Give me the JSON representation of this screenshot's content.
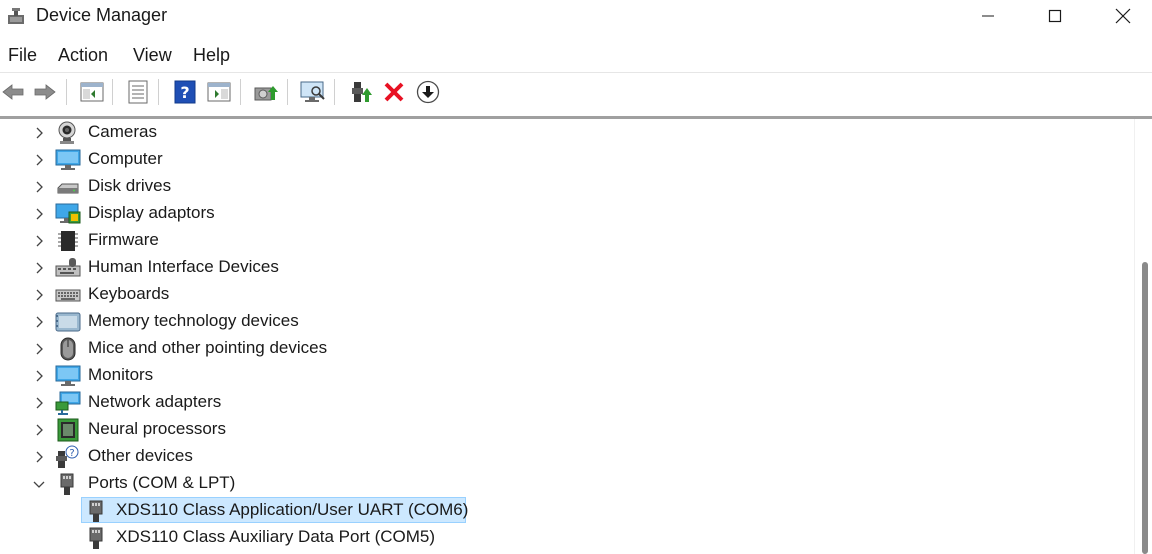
{
  "window": {
    "title": "Device Manager",
    "icon": "device-manager-icon",
    "controls": [
      "minimize-icon",
      "maximize-icon",
      "close-icon"
    ]
  },
  "menu": {
    "file": "File",
    "action": "Action",
    "view": "View",
    "help": "Help"
  },
  "toolbar": {
    "icons": [
      "back-arrow-icon",
      "forward-arrow-icon",
      "show-hide-console-tree-icon",
      "properties-icon",
      "help-icon",
      "action-pane-icon",
      "update-driver-icon",
      "scan-hardware-icon",
      "enable-device-icon",
      "uninstall-device-icon",
      "download-icon"
    ]
  },
  "tree": {
    "categories": [
      {
        "label": "Cameras",
        "icon": "camera-icon",
        "expanded": false
      },
      {
        "label": "Computer",
        "icon": "computer-icon",
        "expanded": false
      },
      {
        "label": "Disk drives",
        "icon": "disk-drive-icon",
        "expanded": false
      },
      {
        "label": "Display adaptors",
        "icon": "display-adapter-icon",
        "expanded": false
      },
      {
        "label": "Firmware",
        "icon": "firmware-icon",
        "expanded": false
      },
      {
        "label": "Human Interface Devices",
        "icon": "hid-icon",
        "expanded": false
      },
      {
        "label": "Keyboards",
        "icon": "keyboard-icon",
        "expanded": false
      },
      {
        "label": "Memory technology devices",
        "icon": "memory-device-icon",
        "expanded": false
      },
      {
        "label": "Mice and other pointing devices",
        "icon": "mouse-icon",
        "expanded": false
      },
      {
        "label": "Monitors",
        "icon": "monitor-icon",
        "expanded": false
      },
      {
        "label": "Network adapters",
        "icon": "network-adapter-icon",
        "expanded": false
      },
      {
        "label": "Neural processors",
        "icon": "neural-processor-icon",
        "expanded": false
      },
      {
        "label": "Other devices",
        "icon": "other-devices-icon",
        "expanded": false
      },
      {
        "label": "Ports (COM & LPT)",
        "icon": "port-icon",
        "expanded": true
      }
    ],
    "ports_children": [
      {
        "label": "XDS110 Class Application/User UART (COM6)",
        "icon": "port-icon",
        "selected": true
      },
      {
        "label": "XDS110 Class Auxiliary Data Port (COM5)",
        "icon": "port-icon",
        "selected": false
      }
    ]
  },
  "colors": {
    "selection_bg": "#cce8ff",
    "selection_border": "#99d1ff",
    "uninstall_red": "#e81123",
    "help_blue": "#1f4fb5"
  }
}
